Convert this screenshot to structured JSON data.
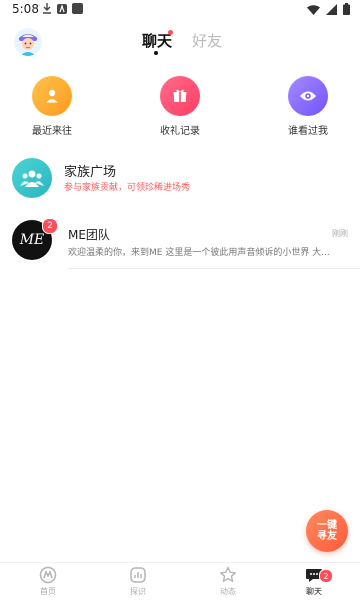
{
  "status_bar": {
    "time": "5:08"
  },
  "header": {
    "tabs": [
      {
        "label": "聊天",
        "active": true
      },
      {
        "label": "好友",
        "active": false
      }
    ]
  },
  "shortcuts": [
    {
      "label": "最近来往",
      "color": "#ffb02e",
      "icon": "person-icon"
    },
    {
      "label": "收礼记录",
      "color": "#ff4d6d",
      "icon": "gift-icon"
    },
    {
      "label": "谁看过我",
      "color": "#8a6bff",
      "icon": "eye-icon"
    }
  ],
  "family": {
    "title": "家族广场",
    "subtitle": "参与家族贡献，可领珍稀进场秀"
  },
  "conversations": [
    {
      "title": "ME团队",
      "avatar_text": "ME",
      "badge": "2",
      "time": "刚刚",
      "preview": "欢迎温柔的你，来到ME 这里是一个彼此用声音倾诉的小世界 大..."
    }
  ],
  "fab": {
    "label": "一键寻友"
  },
  "bottom_nav": {
    "items": [
      {
        "label": "首页",
        "icon": "home-icon"
      },
      {
        "label": "探识",
        "icon": "discover-icon"
      },
      {
        "label": "动态",
        "icon": "star-icon"
      },
      {
        "label": "聊天",
        "icon": "chat-icon",
        "badge": "2",
        "active": true
      }
    ]
  },
  "colors": {
    "accent_red": "#ff4d5a",
    "family_teal": "#26b7c1",
    "fab_orange": "#ff6a45"
  }
}
